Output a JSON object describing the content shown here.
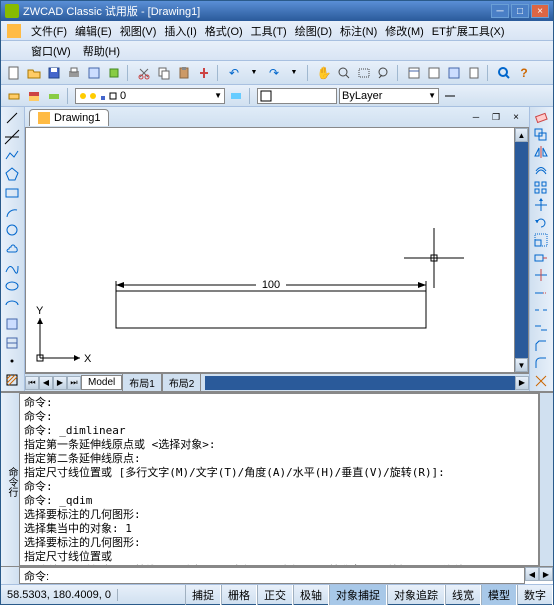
{
  "title": "ZWCAD Classic 试用版 - [Drawing1]",
  "menu": [
    "文件(F)",
    "编辑(E)",
    "视图(V)",
    "插入(I)",
    "格式(O)",
    "工具(T)",
    "绘图(D)",
    "标注(N)",
    "修改(M)",
    "ET扩展工具(X)"
  ],
  "menu2": [
    "窗口(W)",
    "帮助(H)"
  ],
  "layer": {
    "name": "ByLayer"
  },
  "doc": {
    "name": "Drawing1"
  },
  "drawing": {
    "dim_value": "100"
  },
  "layout_tabs": [
    "Model",
    "布局1",
    "布局2"
  ],
  "axis": {
    "x": "X",
    "y": "Y"
  },
  "cmd_history": "命令:\n命令:\n命令: _dimlinear\n指定第一条延伸线原点或 <选择对象>:\n指定第二条延伸线原点:\n指定尺寸线位置或 [多行文字(M)/文字(T)/角度(A)/水平(H)/垂直(V)/旋转(R)]:\n命令:\n命令: _qdim\n选择要标注的几何图形:\n选择集当中的对象: 1\n选择要标注的几何图形:\n指定尺寸线位置或\n [连续(C)/并列(S)/基线(B)/坐标(O)/半径(R)/直径(D)/基准点(P)/编辑(E)]<连续>:",
  "cmd_prompt": "命令:",
  "cmd_side": "命令行",
  "status": {
    "coords": "58.5303, 180.4009, 0",
    "buttons": [
      "捕捉",
      "栅格",
      "正交",
      "极轴",
      "对象捕捉",
      "对象追踪",
      "线宽",
      "模型",
      "数字"
    ]
  },
  "icons": {
    "new": "🗎",
    "open": "📂",
    "save": "💾",
    "print": "🖨",
    "preview": "🔍",
    "cut": "✂",
    "copy": "⎘",
    "paste": "📋",
    "undo": "↶",
    "redo": "↷",
    "pan": "✋",
    "zoom": "🔍",
    "help": "?",
    "props": "⊞"
  }
}
